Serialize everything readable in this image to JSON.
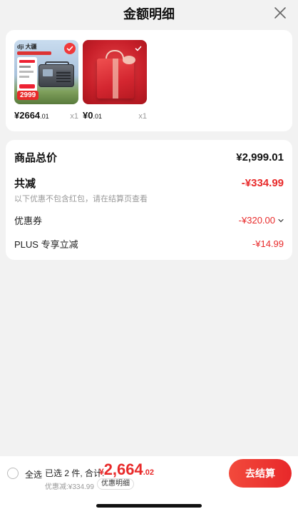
{
  "header": {
    "title": "金额明细"
  },
  "products": [
    {
      "brand": "dji 大疆",
      "badge_price": "2999",
      "price_int": "¥2664",
      "price_dec": ".01",
      "qty": "x1",
      "selected": true
    },
    {
      "price_int": "¥0",
      "price_dec": ".01",
      "qty": "x1",
      "selected": true
    }
  ],
  "summary": {
    "total_label": "商品总价",
    "total_value": "¥2,999.01",
    "reduce_label": "共减",
    "reduce_value": "-¥334.99",
    "reduce_note": "以下优惠不包含红包，请在结算页查看",
    "coupon_label": "优惠券",
    "coupon_value": "-¥320.00",
    "plus_label": "PLUS 专享立减",
    "plus_value": "-¥14.99"
  },
  "bottom": {
    "select_all": "全选",
    "selected_count": "已选 2 件, 合计:",
    "total_currency": "¥",
    "total_int": "2,664",
    "total_dec": ".02",
    "discount_line": "优惠减:¥334.99",
    "detail_label": "优惠明细",
    "checkout_label": "去结算"
  },
  "colors": {
    "accent": "#e82a2a",
    "background": "#f2f2f2"
  },
  "icons": {
    "close": "close-icon",
    "check": "check-icon",
    "chevron": "chevron-down-icon"
  }
}
